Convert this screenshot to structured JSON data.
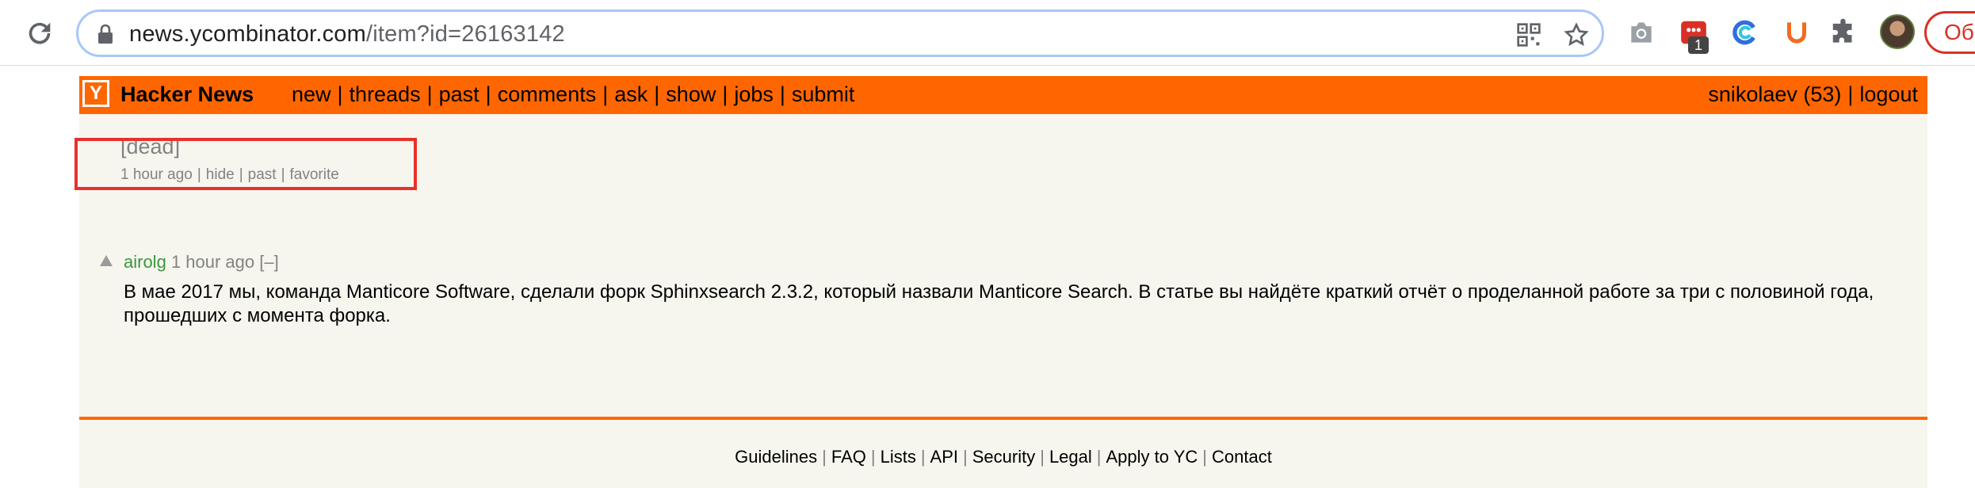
{
  "browser": {
    "url_host": "news.ycombinator.com",
    "url_path": "/item?id=26163142",
    "badge_count": "1",
    "update_label": "Об"
  },
  "hn": {
    "logo_letter": "Y",
    "title": "Hacker News",
    "nav": [
      "new",
      "threads",
      "past",
      "comments",
      "ask",
      "show",
      "jobs",
      "submit"
    ],
    "user": "snikolaev (53)",
    "logout": "logout"
  },
  "story": {
    "title": "[dead]",
    "age": "1 hour ago",
    "actions": [
      "hide",
      "past",
      "favorite"
    ]
  },
  "comment": {
    "user": "airolg",
    "age": "1 hour ago",
    "toggle": "[–]",
    "text": "В мае 2017 мы, команда Manticore Software, сделали форк Sphinxsearch 2.3.2, который назвали Manticore Search. В статье вы найдёте краткий отчёт о проделанной работе за три с половиной года, прошедших с момента форка."
  },
  "footer": {
    "links": [
      "Guidelines",
      "FAQ",
      "Lists",
      "API",
      "Security",
      "Legal",
      "Apply to YC",
      "Contact"
    ]
  },
  "colors": {
    "hn_orange": "#ff6600",
    "hn_background": "#f6f6ef",
    "annotation_red": "#e8312a",
    "comment_user_green": "#3c963c"
  }
}
